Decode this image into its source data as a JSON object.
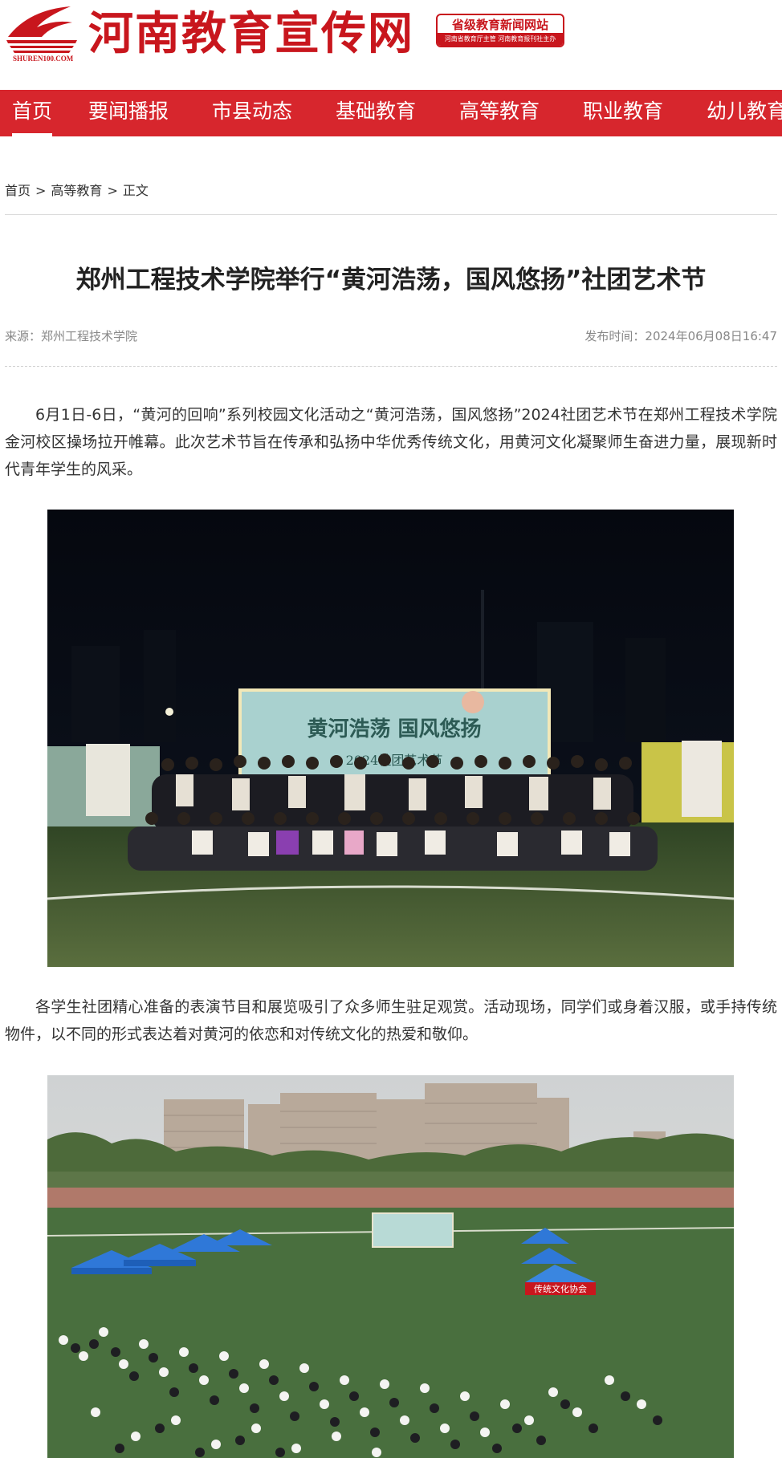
{
  "site": {
    "title": "河南教育宣传网",
    "logo_text": "SHUREN100.COM",
    "badge_main": "省级教育新闻网站",
    "badge_sub": "河南省教育厅主管 河南教育报刊社主办",
    "brand_color": "#c8161d"
  },
  "nav": {
    "items": [
      {
        "label": "首页",
        "active": true
      },
      {
        "label": "要闻播报"
      },
      {
        "label": "市县动态"
      },
      {
        "label": "基础教育"
      },
      {
        "label": "高等教育"
      },
      {
        "label": "职业教育"
      },
      {
        "label": "幼儿教育"
      }
    ],
    "bg_color": "#d7262d"
  },
  "breadcrumb": {
    "home": "首页",
    "section": "高等教育",
    "current": "正文",
    "separator": ">"
  },
  "article": {
    "title": "郑州工程技术学院举行“黄河浩荡，国风悠扬”社团艺术节",
    "source": "来源：郑州工程技术学院",
    "published": "发布时间：2024年06月08日16:47",
    "paragraph1": "6月1日-6日，“黄河的回响”系列校园文化活动之“黄河浩荡，国风悠扬”2024社团艺术节在郑州工程技术学院金河校区操场拉开帷幕。此次艺术节旨在传承和弘扬中华优秀传统文化，用黄河文化凝聚师生奋进力量，展现新时代青年学生的风采。",
    "paragraph2": "各学生社团精心准备的表演节目和展览吸引了众多师生驻足观赏。活动现场，同学们或身着汉服，或手持传统物件，以不同的形式表达着对黄河的依恋和对传统文化的热爱和敬仰。",
    "photo1_banner_line1": "黄河浩荡  国风悠扬",
    "photo1_banner_line2": "2024社团艺术节",
    "photo2_tent_label": "传统文化协会"
  }
}
